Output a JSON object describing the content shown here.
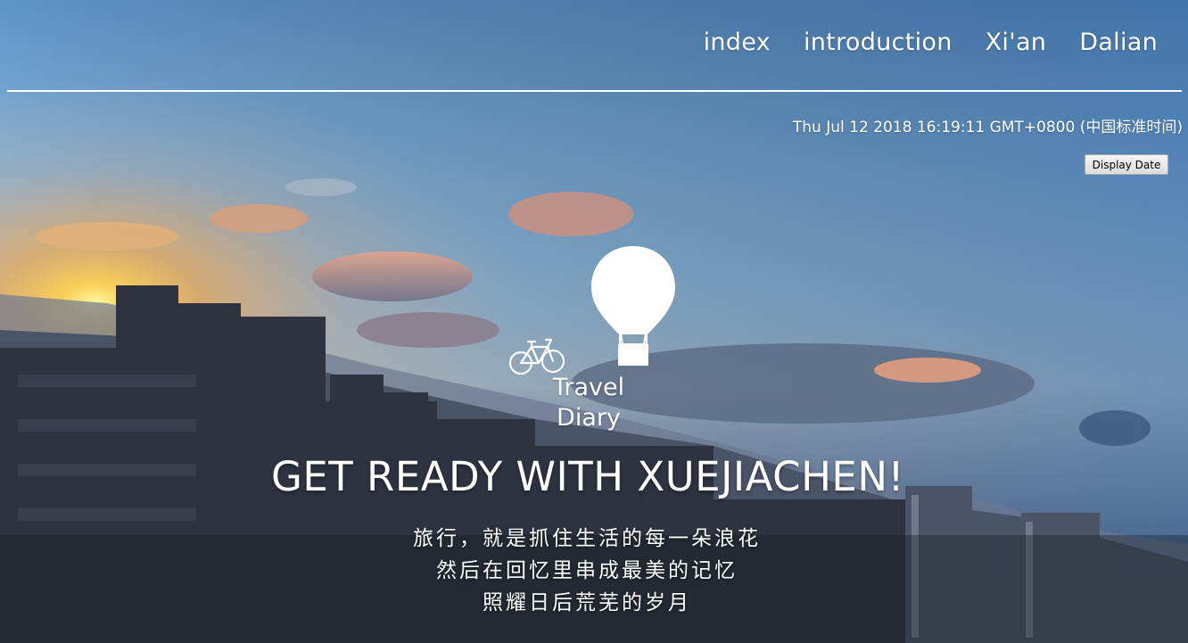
{
  "nav": {
    "items": [
      "index",
      "introduction",
      "Xi'an",
      "Dalian"
    ]
  },
  "datetime": "Thu Jul 12 2018 16:19:11 GMT+0800 (中国标准时间)",
  "display_date_button": "Display Date",
  "logo": {
    "line1": "Travel",
    "line2": "Diary",
    "icons": [
      "hot-air-balloon-icon",
      "bicycle-icon"
    ]
  },
  "headline": "GET READY WITH XUEJIACHEN!",
  "tagline": [
    "旅行，就是抓住生活的每一朵浪花",
    "然后在回忆里串成最美的记忆",
    "照耀日后荒芜的岁月"
  ],
  "colors": {
    "text": "#ffffff",
    "sky_top": "#4f86c0",
    "sunset": "#f2a64a"
  }
}
